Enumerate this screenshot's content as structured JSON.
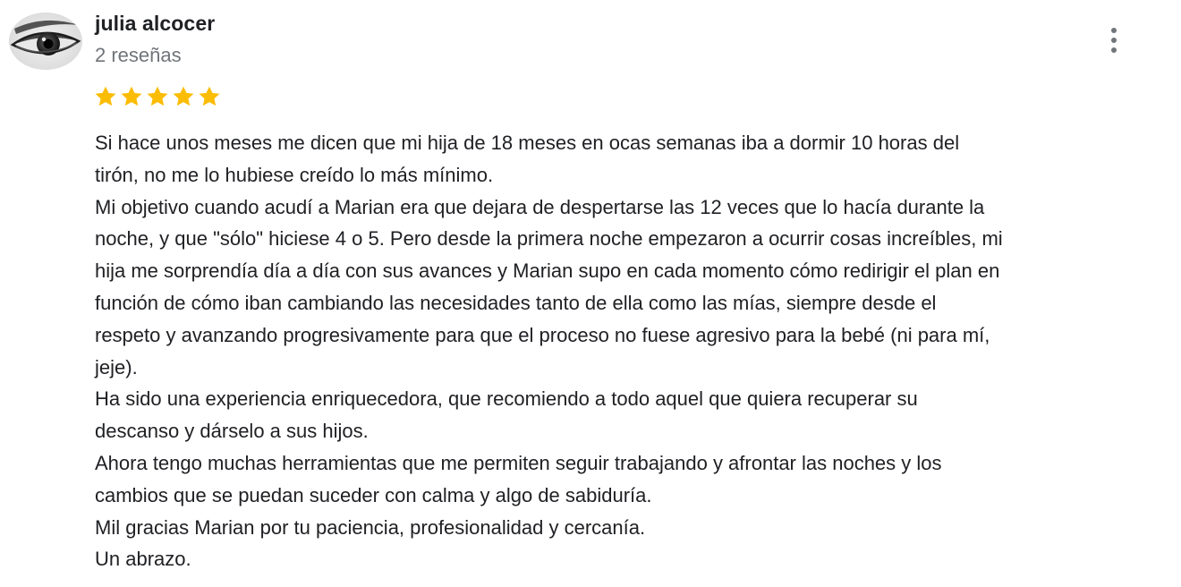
{
  "author": {
    "name": "julia alcocer",
    "review_count": "2 reseñas",
    "avatar_icon": "eye-photo-icon"
  },
  "menu": {
    "icon": "more-vert-icon"
  },
  "rating": {
    "stars": 5,
    "max": 5,
    "star_color": "#fbbc04"
  },
  "review": {
    "lines": [
      "Si hace unos meses me dicen que mi hija de 18 meses en ocas semanas iba a dormir 10 horas del",
      "tirón, no me lo hubiese creído lo más mínimo.",
      "Mi objetivo cuando acudí a Marian era que dejara de despertarse las 12 veces que lo hacía durante la",
      "noche, y que \"sólo\" hiciese 4 o 5. Pero desde la primera noche empezaron a ocurrir cosas increíbles, mi",
      "hija me sorprendía día a día con sus avances y Marian supo en cada momento cómo redirigir el plan en",
      "función de cómo iban cambiando las necesidades tanto de ella como las mías, siempre desde el",
      "respeto y avanzando progresivamente para que el proceso no fuese agresivo para la bebé (ni para mí,",
      "jeje).",
      "Ha sido una experiencia enriquecedora, que recomiendo a todo aquel que quiera recuperar su",
      "descanso y dárselo a sus hijos.",
      "Ahora tengo muchas herramientas que me permiten seguir trabajando y afrontar las noches y los",
      "cambios que se puedan suceder con calma y algo de sabiduría.",
      "Mil gracias Marian por tu paciencia, profesionalidad y cercanía.",
      "Un abrazo."
    ]
  }
}
